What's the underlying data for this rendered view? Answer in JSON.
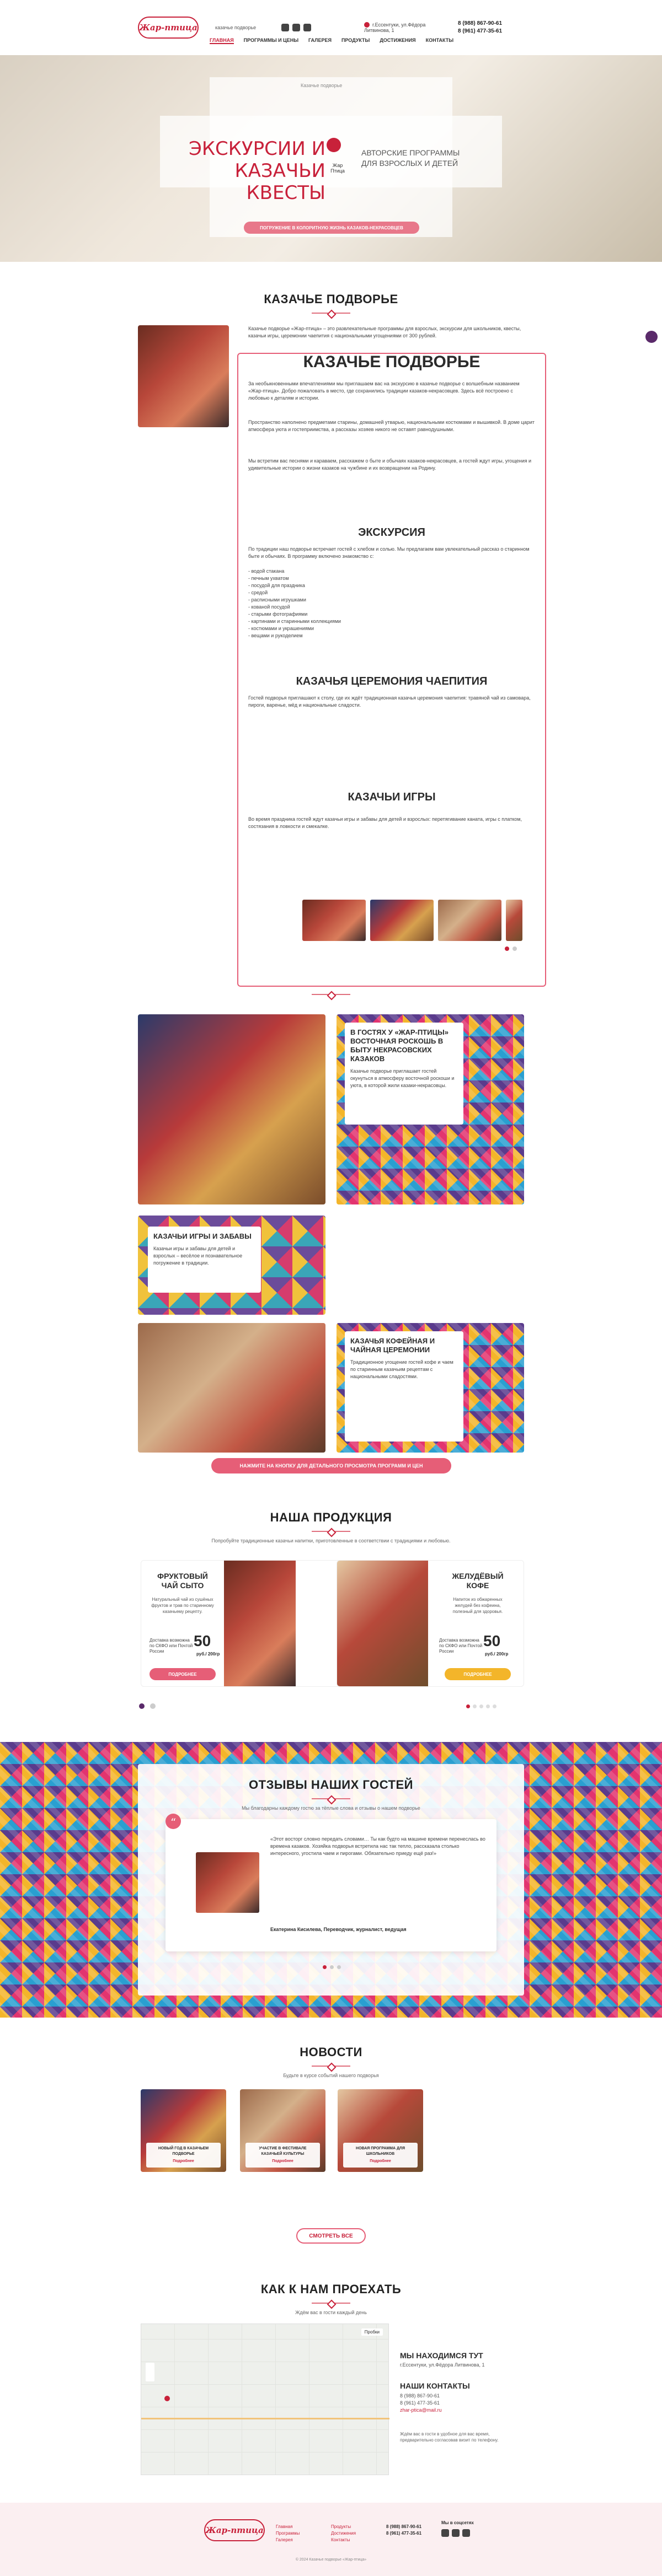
{
  "header": {
    "logo": "Жар-птица",
    "subtitle": "казачье подворье",
    "address": "г.Ессентуки, ул.Фёдора Литвинова, 1",
    "phone1": "8 (988) 867-90-61",
    "phone2": "8 (961) 477-35-61"
  },
  "nav": [
    "ГЛАВНАЯ",
    "ПРОГРАММЫ И ЦЕНЫ",
    "ГАЛЕРЕЯ",
    "ПРОДУКТЫ",
    "ДОСТИЖЕНИЯ",
    "КОНТАКТЫ"
  ],
  "hero": {
    "breadcrumb": "Казачье подворье",
    "title": "ЭКСКУРСИИ И КАЗАЧЬИ КВЕСТЫ",
    "brand": "Жар Птица",
    "right_text": "АВТОРСКИЕ ПРОГРАММЫ ДЛЯ ВЗРОСЛЫХ И ДЕТЕЙ",
    "button": "ПОГРУЖЕНИЕ В КОЛОРИТНУЮ ЖИЗНЬ КАЗАКОВ-НЕКРАСОВЦЕВ"
  },
  "main": {
    "title": "КАЗАЧЬЕ ПОДВОРЬЕ",
    "intro": "Казачье подворье «Жар-птица» – это развлекательные программы для взрослых, экскурсии для школьников, квесты, казачьи игры, церемонии чаепития с национальными угощениями от 300 рублей.",
    "h_main": "КАЗАЧЬЕ ПОДВОРЬЕ",
    "p1": "За необыкновенными впечатлениями мы приглашаем вас на экскурсию в казачье подворье с волшебным названием «Жар-птица». Добро пожаловать в место, где сохранились традиции казаков-некрасовцев. Здесь всё построено с любовью к деталям и истории.",
    "p2": "Пространство наполнено предметами старины, домашней утварью, национальными костюмами и вышивкой. В доме царит атмосфера уюта и гостеприимства, а рассказы хозяев никого не оставят равнодушными.",
    "p3": "Мы встретим вас песнями и караваем, расскажем о быте и обычаях казаков-некрасовцев, а гостей ждут игры, угощения и удивительные истории о жизни казаков на чужбине и их возвращении на Родину.",
    "h_excursion": "ЭКСКУРСИЯ",
    "excursion": "По традиции наш подворье встречает гостей с хлебом и солью. Мы предлагаем вам увлекательный рассказ о старинном быте и обычаях. В программу включено знакомство с:",
    "excursion_list": [
      "- водой стакана",
      "- печным ухватом",
      "- посудой для праздника",
      "- средой",
      "- расписными игрушками",
      "- кованой посудой",
      "- старыми фотографиями",
      "- картинами и старинными коллекциями",
      "- костюмами и украшениями",
      "- вещами и рукоделием"
    ],
    "h_tea": "КАЗАЧЬЯ ЦЕРЕМОНИЯ ЧАЕПИТИЯ",
    "tea": "Гостей подворья приглашают к столу, где их ждёт традиционная казачья церемония чаепития: травяной чай из самовара, пироги, варенье, мёд и национальные сладости.",
    "h_games": "КАЗАЧЬИ ИГРЫ",
    "games": "Во время праздника гостей ждут казачьи игры и забавы для детей и взрослых: перетягивание каната, игры с платком, состязания в ловкости и смекалке."
  },
  "feature_blocks": [
    {
      "title": "В ГОСТЯХ У «ЖАР-ПТИЦЫ» ВОСТОЧНАЯ РОСКОШЬ В БЫТУ НЕКРАСОВСКИХ КАЗАКОВ",
      "text": "Казачье подворье приглашает гостей окунуться в атмосферу восточной роскоши и уюта, в которой жили казаки-некрасовцы."
    },
    {
      "title": "КАЗАЧЬИ ИГРЫ И ЗАБАВЫ",
      "text": "Казачьи игры и забавы для детей и взрослых – весёлое и познавательное погружение в традиции."
    },
    {
      "title": "КАЗАЧЬЯ КОФЕЙНАЯ И ЧАЙНАЯ ЦЕРЕМОНИИ",
      "text": "Традиционное угощение гостей кофе и чаем по старинным казачьим рецептам с национальными сладостями."
    }
  ],
  "programs_button": "НАЖМИТЕ НА КНОПКУ ДЛЯ ДЕТАЛЬНОГО ПРОСМОТРА ПРОГРАММ И ЦЕН",
  "products": {
    "title": "НАША ПРОДУКЦИЯ",
    "subtitle": "Попробуйте традиционные казачьи напитки, приготовленные в соответствии с традициями и любовью.",
    "items": [
      {
        "name": "ФРУКТОВЫЙ ЧАЙ СЫТО",
        "desc": "Натуральный чай из сушёных фруктов и трав по старинному казачьему рецепту.",
        "delivery": "Доставка возможна по СКФО или Почтой России",
        "price": "50",
        "unit": "руб./ 200гр",
        "button": "ПОДРОБНЕЕ",
        "color": "#e65e77"
      },
      {
        "name": "ЖЕЛУДЁВЫЙ КОФЕ",
        "desc": "Напиток из обжаренных желудей без кофеина, полезный для здоровья.",
        "delivery": "Доставка возможна по СКФО или Почтой России",
        "price": "50",
        "unit": "руб./ 200гр",
        "button": "ПОДРОБНЕЕ",
        "color": "#f3b52a"
      }
    ]
  },
  "reviews": {
    "title": "ОТЗЫВЫ НАШИХ ГОСТЕЙ",
    "subtitle": "Мы благодарны каждому гостю за тёплые слова и отзывы о нашем подворье",
    "text": "«Этот восторг словно передать словами… Ты как будто на машине времени перенеслась во времена казаков. Хозяйка подворья встретила нас так тепло, рассказала столько интересного, угостила чаем и пирогами. Обязательно приеду ещё раз!»",
    "author": "Екатерина Кисилева, Переводчик, журналист, ведущая"
  },
  "news": {
    "title": "НОВОСТИ",
    "subtitle": "Будьте в курсе событий нашего подворья",
    "items": [
      {
        "title": "НОВЫЙ ГОД В КАЗАЧЬЕМ ПОДВОРЬЕ",
        "date": "Подробнее"
      },
      {
        "title": "УЧАСТИЕ В ФЕСТИВАЛЕ КАЗАЧЬЕЙ КУЛЬТУРЫ",
        "date": "Подробнее"
      },
      {
        "title": "НОВАЯ ПРОГРАММА ДЛЯ ШКОЛЬНИКОВ",
        "date": "Подробнее"
      }
    ],
    "button": "СМОТРЕТЬ ВСЕ"
  },
  "contacts": {
    "title": "КАК К НАМ ПРОЕХАТЬ",
    "subtitle": "Ждём вас в гости каждый день",
    "where_title": "МЫ НАХОДИМСЯ ТУТ",
    "where": "г.Ессентуки, ул.Фёдора Литвинова, 1",
    "contacts_title": "НАШИ КОНТАКТЫ",
    "phone1": "8 (988) 867-90-61",
    "phone2": "8 (961) 477-35-61",
    "email": "zhar-ptica@mail.ru",
    "note": "Ждём вас в гости в удобное для вас время, предварительно согласовав визит по телефону.",
    "map_search": "Пробки"
  },
  "footer": {
    "logo": "Жар-птица",
    "col1": [
      "Главная",
      "Программы",
      "Галерея"
    ],
    "col2": [
      "Продукты",
      "Достижения",
      "Контакты"
    ],
    "phone1": "8 (988) 867-90-61",
    "phone2": "8 (961) 477-35-61",
    "social_title": "Мы в соцсетях",
    "copy": "© 2024 Казачье подворье «Жар-птица»"
  }
}
